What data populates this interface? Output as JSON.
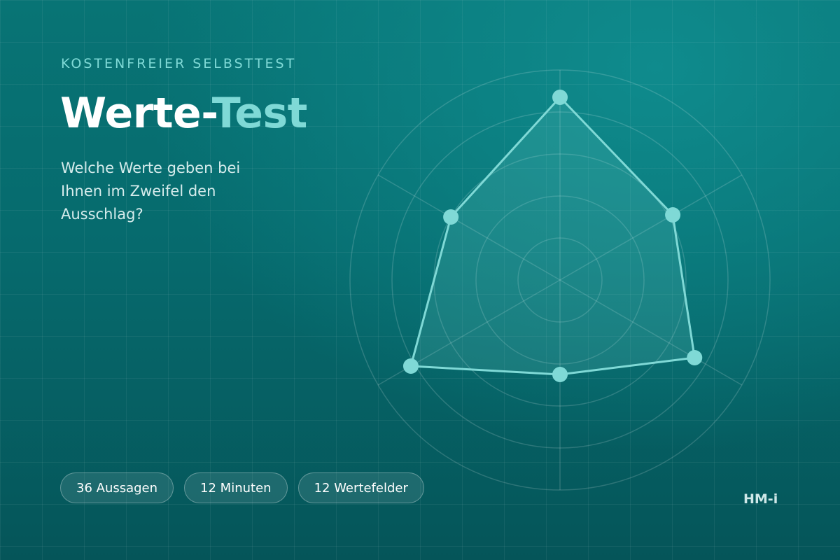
{
  "eyebrow": "KOSTENFREIER SELBSTTEST",
  "title": {
    "main": "Werte-",
    "accent": "Test"
  },
  "subtitle": "Welche Werte geben bei Ihnen im Zweifel den Ausschlag?",
  "stats": [
    {
      "label": "36 Aussagen"
    },
    {
      "label": "12 Minuten"
    },
    {
      "label": "12 Wertefelder"
    }
  ],
  "brand": "HM-i",
  "colors": {
    "accent": "#7fd9d6",
    "background_top": "#087475",
    "background_bottom": "#055559",
    "text": "#ffffff"
  },
  "chart_data": {
    "type": "radar",
    "axes_count": 6,
    "rings": 5,
    "values": [
      0.87,
      0.62,
      0.74,
      0.45,
      0.82,
      0.6
    ]
  }
}
